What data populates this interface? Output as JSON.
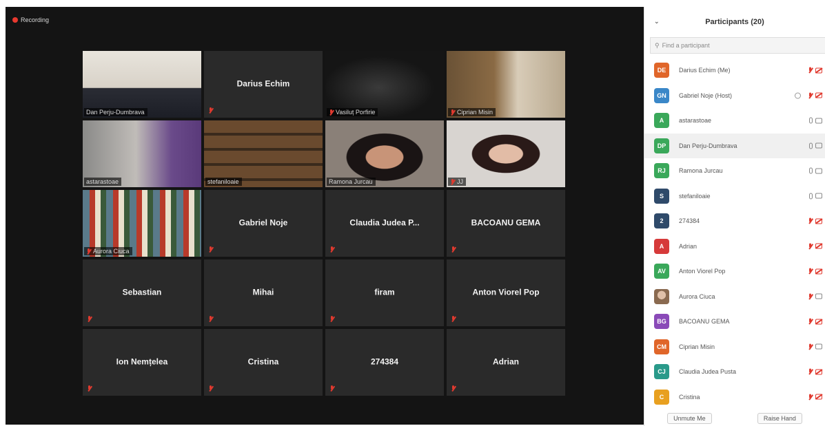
{
  "recording": {
    "label": "Recording"
  },
  "tiles": [
    {
      "name": "Dan Perju-Dumbrava",
      "video": true,
      "photo": "office"
    },
    {
      "name": "Darius Echim",
      "video": false
    },
    {
      "name": "Vasiluț Porfirie",
      "video": true,
      "photo": "dark"
    },
    {
      "name": "Ciprian Misin",
      "video": true,
      "photo": "cross"
    },
    {
      "name": "astarastoae",
      "video": true,
      "photo": "purple",
      "active": true
    },
    {
      "name": "stefaniloaie",
      "video": true,
      "photo": "shelves"
    },
    {
      "name": "Ramona Jurcau",
      "video": true,
      "photo": "woman"
    },
    {
      "name": "JJ",
      "video": true,
      "photo": "woman2"
    },
    {
      "name": "Aurora Ciuca",
      "video": true,
      "photo": "books"
    },
    {
      "name": "Gabriel Noje",
      "video": false
    },
    {
      "name": "Claudia Judea P...",
      "video": false
    },
    {
      "name": "BACOANU GEMA",
      "video": false
    },
    {
      "name": "Sebastian",
      "video": false
    },
    {
      "name": "Mihai",
      "video": false
    },
    {
      "name": "firam",
      "video": false
    },
    {
      "name": "Anton Viorel Pop",
      "video": false
    },
    {
      "name": "Ion Nemțelea",
      "video": false
    },
    {
      "name": "Cristina",
      "video": false
    },
    {
      "name": "274384",
      "video": false
    },
    {
      "name": "Adrian",
      "video": false
    }
  ],
  "panel": {
    "title": "Participants (20)",
    "search_placeholder": "Find a participant",
    "participants": [
      {
        "initials": "DE",
        "name": "Darius Echim (Me)",
        "color": "#e0662a",
        "mic": "muted",
        "cam": "off"
      },
      {
        "initials": "GN",
        "name": "Gabriel Noje (Host)",
        "color": "#3a87c8",
        "mic": "muted",
        "cam": "off",
        "host": true
      },
      {
        "initials": "A",
        "name": "astarastoae",
        "color": "#3aa85a",
        "mic": "on",
        "cam": "on"
      },
      {
        "initials": "DP",
        "name": "Dan Perju-Dumbrava",
        "color": "#3aa85a",
        "mic": "on",
        "cam": "on",
        "highlight": true
      },
      {
        "initials": "RJ",
        "name": "Ramona Jurcau",
        "color": "#3aa85a",
        "mic": "on",
        "cam": "on"
      },
      {
        "initials": "S",
        "name": "stefaniloaie",
        "color": "#2f4a6a",
        "mic": "on",
        "cam": "on"
      },
      {
        "initials": "2",
        "name": "274384",
        "color": "#2f4a6a",
        "mic": "muted",
        "cam": "off"
      },
      {
        "initials": "A",
        "name": "Adrian",
        "color": "#d63a3a",
        "mic": "muted",
        "cam": "off"
      },
      {
        "initials": "AV",
        "name": "Anton Viorel Pop",
        "color": "#3aa85a",
        "mic": "muted",
        "cam": "off"
      },
      {
        "initials": "",
        "name": "Aurora Ciuca",
        "color": "#b89070",
        "mic": "muted",
        "cam": "on",
        "photo": true
      },
      {
        "initials": "BG",
        "name": "BACOANU GEMA",
        "color": "#8a4ab8",
        "mic": "muted",
        "cam": "off"
      },
      {
        "initials": "CM",
        "name": "Ciprian Misin",
        "color": "#e0662a",
        "mic": "muted",
        "cam": "on"
      },
      {
        "initials": "CJ",
        "name": "Claudia Judea Pusta",
        "color": "#2a9a8a",
        "mic": "muted",
        "cam": "off"
      },
      {
        "initials": "C",
        "name": "Cristina",
        "color": "#e8a020",
        "mic": "muted",
        "cam": "off"
      }
    ],
    "unmute_label": "Unmute Me",
    "raise_hand_label": "Raise Hand"
  }
}
